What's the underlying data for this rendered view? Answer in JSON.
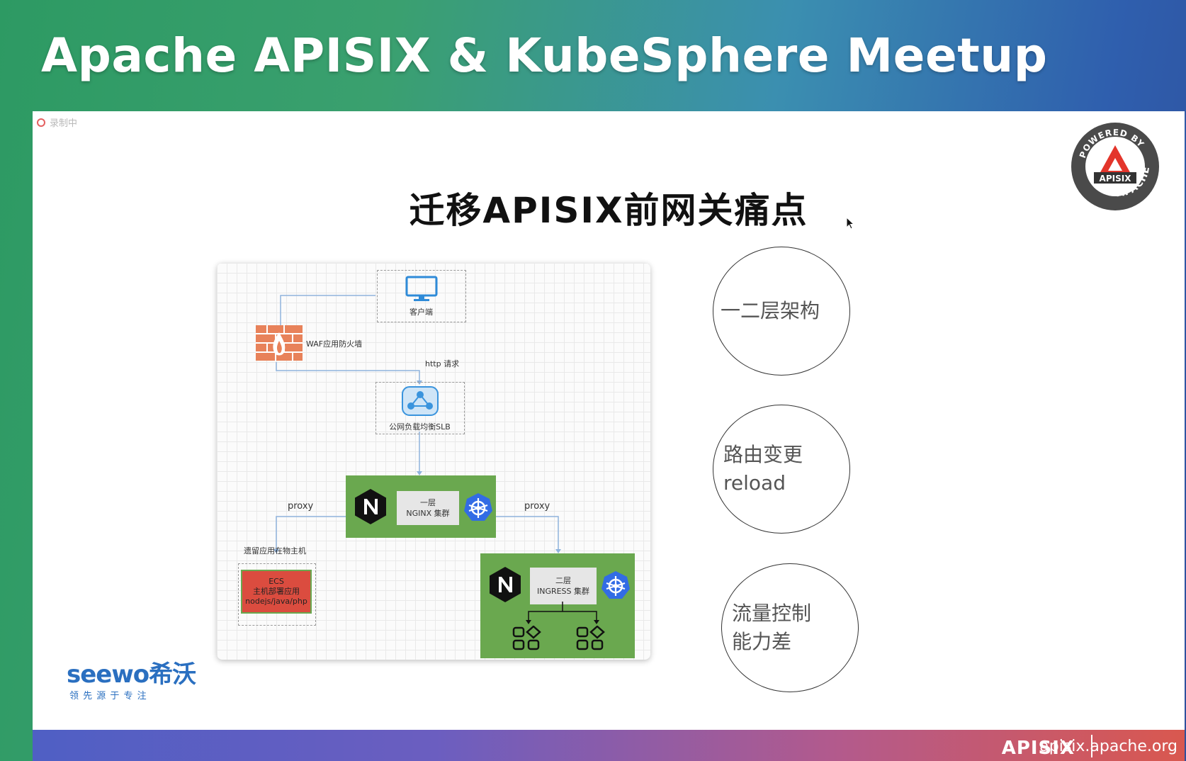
{
  "header": {
    "title": "Apache APISIX & KubeSphere Meetup"
  },
  "recording": {
    "label": "录制中"
  },
  "slide": {
    "title": "迁移APISIX前网关痛点",
    "badge": {
      "top_text": "POWERED BY",
      "center_text": "APISIX",
      "bottom_text": "APACHE"
    },
    "diagram": {
      "client": "客户端",
      "waf": "WAF应用防火墙",
      "http_request": "http 请求",
      "slb": "公网负载均衡SLB",
      "nginx_cluster": {
        "line1": "一层",
        "line2": "NGINX 集群"
      },
      "proxy_left": "proxy",
      "proxy_right": "proxy",
      "legacy_label": "遗留应用在物主机",
      "ecs": {
        "line1": "ECS",
        "line2": "主机部署应用",
        "line3": "nodejs/java/php"
      },
      "ingress_cluster": {
        "line1": "二层",
        "line2": "INGRESS 集群"
      }
    },
    "pain_points": [
      {
        "line1": "一二层架构",
        "line2": ""
      },
      {
        "line1": "路由变更",
        "line2": "reload"
      },
      {
        "line1": "流量控制",
        "line2": "能力差"
      }
    ],
    "seewo": {
      "brand": "seewo希沃",
      "slogan": "领 先 源 于 专 注"
    },
    "footer": {
      "brand": "APISIX",
      "url": "apisix.apache.org"
    }
  },
  "colors": {
    "nginx_green": "#6aa84f",
    "ecs_red": "#db4c3f",
    "k8s_blue": "#326ce5",
    "waf_orange": "#e8825a"
  }
}
